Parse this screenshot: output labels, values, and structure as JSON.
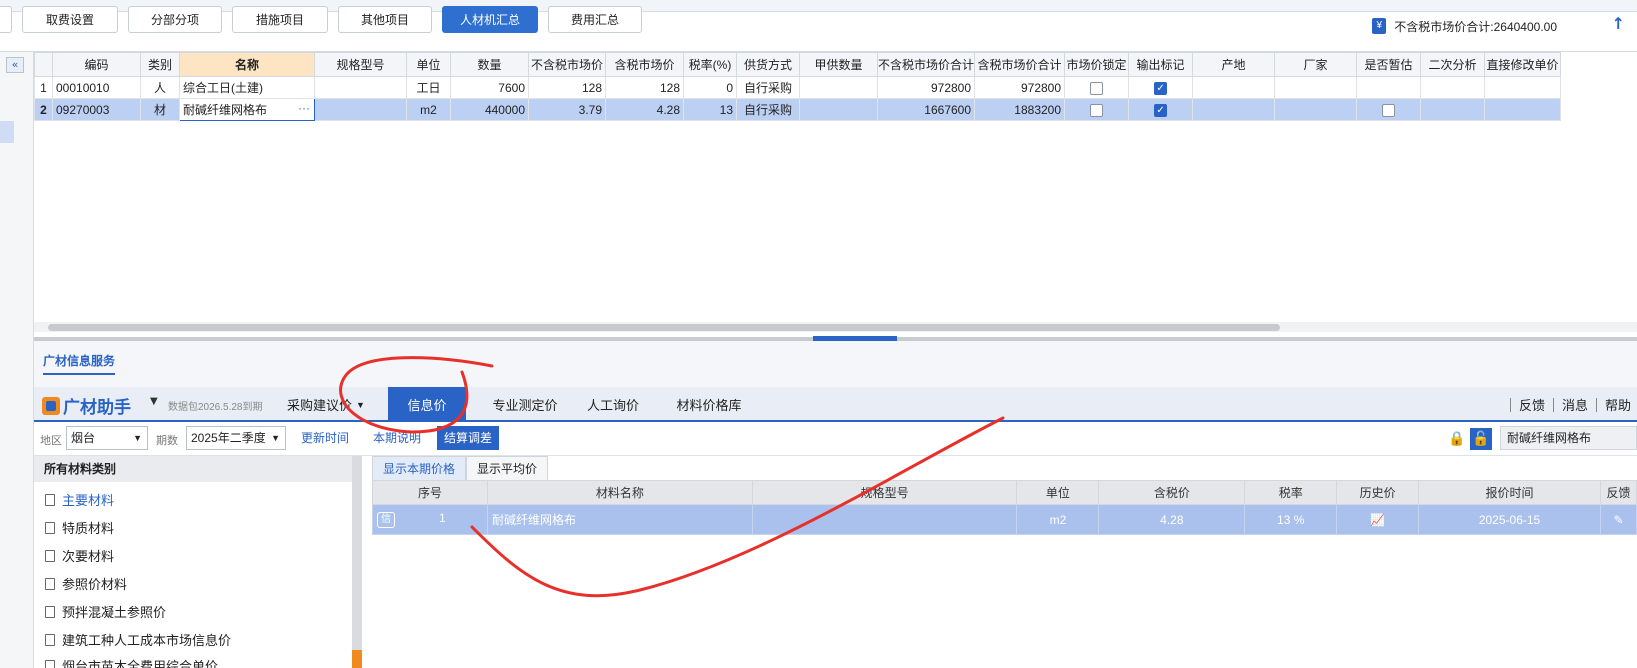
{
  "toolbar": {
    "buttons": [
      "取费设置",
      "分部分项",
      "措施项目",
      "其他项目",
      "人材机汇总",
      "费用汇总"
    ],
    "total_label": "不含税市场价合计:2640400.00",
    "yen_icon": "¥"
  },
  "grid": {
    "headers": [
      "编码",
      "类别",
      "名称",
      "规格型号",
      "单位",
      "数量",
      "不含税市场价",
      "含税市场价",
      "税率(%)",
      "供货方式",
      "甲供数量",
      "不含税市场价合计",
      "含税市场价合计",
      "市场价锁定",
      "输出标记",
      "产地",
      "厂家",
      "是否暂估",
      "二次分析",
      "直接修改单价"
    ],
    "rows": [
      {
        "idx": "1",
        "code": "00010010",
        "type": "人",
        "name": "综合工日(土建)",
        "spec": "",
        "unit": "工日",
        "qty": "7600",
        "price_ex": "128",
        "price_in": "128",
        "tax": "0",
        "supply": "自行采购",
        "jia_qty": "",
        "total_ex": "972800",
        "total_in": "972800"
      },
      {
        "idx": "2",
        "code": "09270003",
        "type": "材",
        "name": "耐碱纤维网格布",
        "spec": "",
        "unit": "m2",
        "qty": "440000",
        "price_ex": "3.79",
        "price_in": "4.28",
        "tax": "13",
        "supply": "自行采购",
        "jia_qty": "",
        "total_ex": "1667600",
        "total_in": "1883200",
        "more": "···"
      }
    ]
  },
  "service": {
    "tab": "广材信息服务"
  },
  "nav": {
    "brand": "广材助手",
    "data_pkg": "数据包2026.5.28到期",
    "items": [
      "采购建议价",
      "信息价",
      "专业测定价",
      "人工询价",
      "材料价格库"
    ],
    "right": [
      "反馈",
      "消息",
      "帮助"
    ]
  },
  "filter": {
    "region_label": "地区",
    "region": "烟台",
    "period_label": "期数",
    "period": "2025年二季度",
    "update_time": "更新时间",
    "period_note": "本期说明",
    "settle_adjust": "结算调差",
    "search": "耐碱纤维网格布"
  },
  "categories": {
    "header": "所有材料类别",
    "items": [
      "主要材料",
      "特质材料",
      "次要材料",
      "参照价材料",
      "预拌混凝土参照价",
      "建筑工种人工成本市场信息价",
      "烟台市苗木全费用综合单价"
    ]
  },
  "price": {
    "subtabs": [
      "显示本期价格",
      "显示平均价"
    ],
    "headers": [
      "序号",
      "材料名称",
      "规格型号",
      "单位",
      "含税价",
      "税率",
      "历史价",
      "报价时间",
      "反馈"
    ],
    "row": {
      "badge": "信",
      "seq": "1",
      "name": "耐碱纤维网格布",
      "spec": "",
      "unit": "m2",
      "price": "4.28",
      "tax": "13 %",
      "time": "2025-06-15"
    }
  },
  "colors": {
    "accent": "#2a63c6",
    "annotation": "#e8302a"
  }
}
